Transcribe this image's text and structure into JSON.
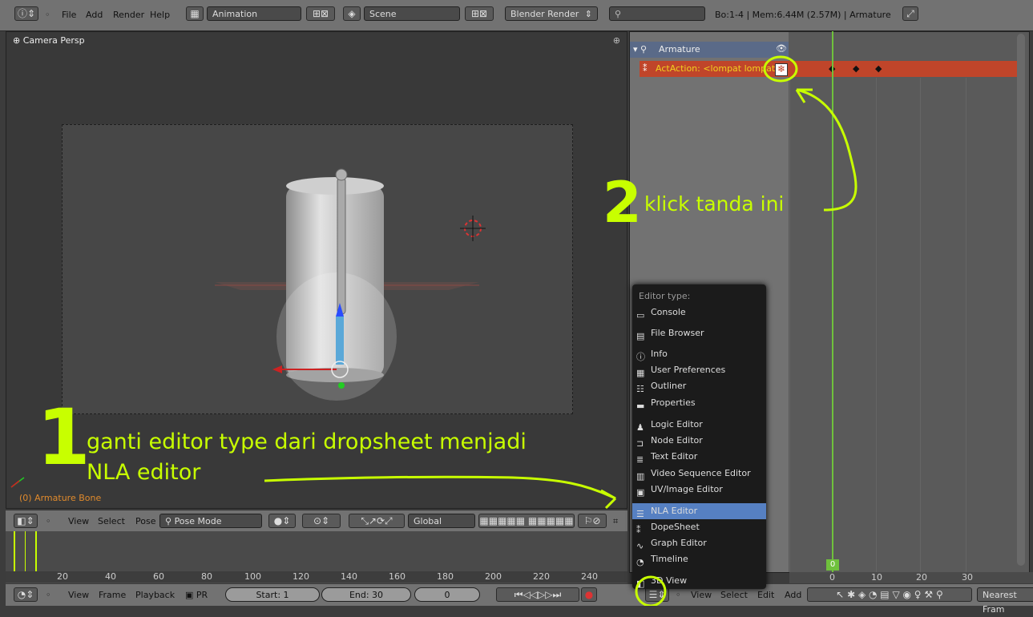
{
  "topbar": {
    "menus": [
      "File",
      "Add",
      "Render",
      "Help"
    ],
    "layout": "Animation",
    "scene": "Scene",
    "engine": "Blender Render",
    "stats": "Bo:1-4 | Mem:6.44M (2.57M) | Armature"
  },
  "viewport": {
    "label": "Camera Persp",
    "bone_label": "(0) Armature Bone",
    "header": {
      "menus": [
        "View",
        "Select",
        "Pose"
      ],
      "mode": "Pose Mode",
      "orientation": "Global"
    }
  },
  "nla": {
    "object": "Armature",
    "action": "ActAction: <lompat lompat>",
    "current_frame": "0",
    "ruler": [
      "0",
      "10",
      "20",
      "30"
    ]
  },
  "timeline": {
    "ruler": [
      "20",
      "40",
      "60",
      "80",
      "100",
      "120",
      "140",
      "160",
      "180",
      "200",
      "220",
      "240"
    ],
    "header_menus": [
      "View",
      "Frame",
      "Playback"
    ],
    "pr": "PR",
    "start": "Start: 1",
    "end": "End: 30",
    "frame": "0"
  },
  "nla_header": {
    "menus": [
      "View",
      "Select",
      "Edit",
      "Add"
    ],
    "snap": "Nearest Fram"
  },
  "menu": {
    "title": "Editor type:",
    "items": [
      "Console",
      "File Browser",
      "Info",
      "User Preferences",
      "Outliner",
      "Properties",
      "Logic Editor",
      "Node Editor",
      "Text Editor",
      "Video Sequence Editor",
      "UV/Image Editor",
      "NLA Editor",
      "DopeSheet",
      "Graph Editor",
      "Timeline",
      "3D View"
    ]
  },
  "annotations": {
    "num1": "1",
    "text1_line1": "ganti editor type dari dropsheet menjadi",
    "text1_line2": "NLA editor",
    "num2": "2",
    "text2": "klick tanda ini"
  },
  "colors": {
    "accent": "#c8ff00",
    "selection": "#5680c2",
    "action_strip": "#c0452a",
    "playhead": "#6fc13c"
  }
}
